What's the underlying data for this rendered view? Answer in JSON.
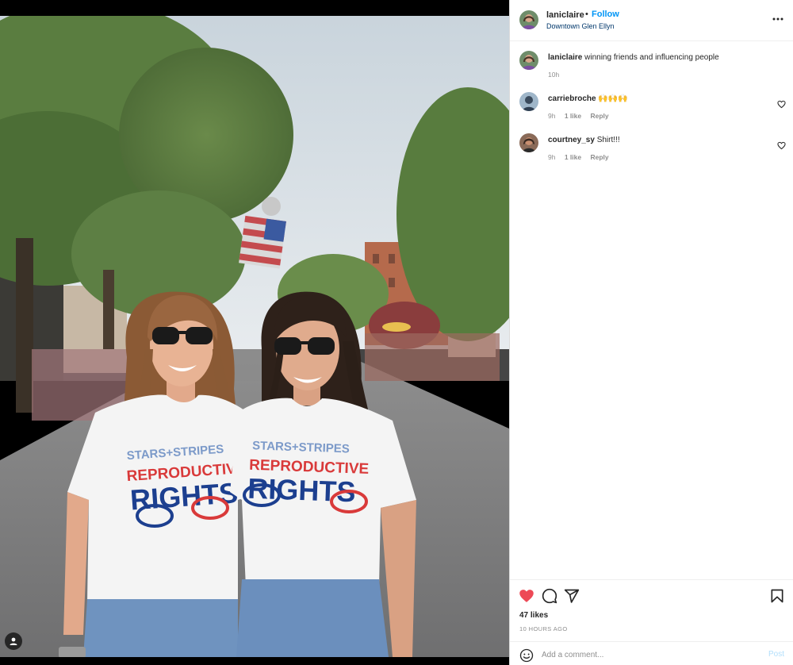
{
  "post": {
    "username": "laniclaire",
    "separator": "•",
    "follow_label": "Follow",
    "location": "Downtown Glen Ellyn",
    "photo_alt": "Photo by laniclaire in Downtown Glen Ellyn"
  },
  "caption": {
    "username": "laniclaire",
    "text": "winning friends and influencing people",
    "time": "10h"
  },
  "comments": [
    {
      "username": "carriebroche",
      "text": "🙌🙌🙌",
      "time": "9h",
      "likes": "1 like",
      "reply": "Reply"
    },
    {
      "username": "courtney_sy",
      "text": "Shirt!!!",
      "time": "9h",
      "likes": "1 like",
      "reply": "Reply"
    }
  ],
  "actions": {
    "likes_text": "47 likes",
    "time_text": "10 HOURS AGO",
    "liked": true
  },
  "composer": {
    "placeholder": "Add a comment...",
    "post_label": "Post"
  },
  "icons": {
    "more": "more-horizontal-icon",
    "like": "heart-filled-icon",
    "comment": "comment-bubble-icon",
    "share": "paper-plane-icon",
    "save": "bookmark-icon",
    "emoji": "emoji-smile-icon",
    "tag": "user-tag-icon"
  },
  "colors": {
    "accent": "#0095f6",
    "like_red": "#ed4956",
    "muted": "#8e8e8e",
    "post_disabled": "#b2dffc"
  }
}
